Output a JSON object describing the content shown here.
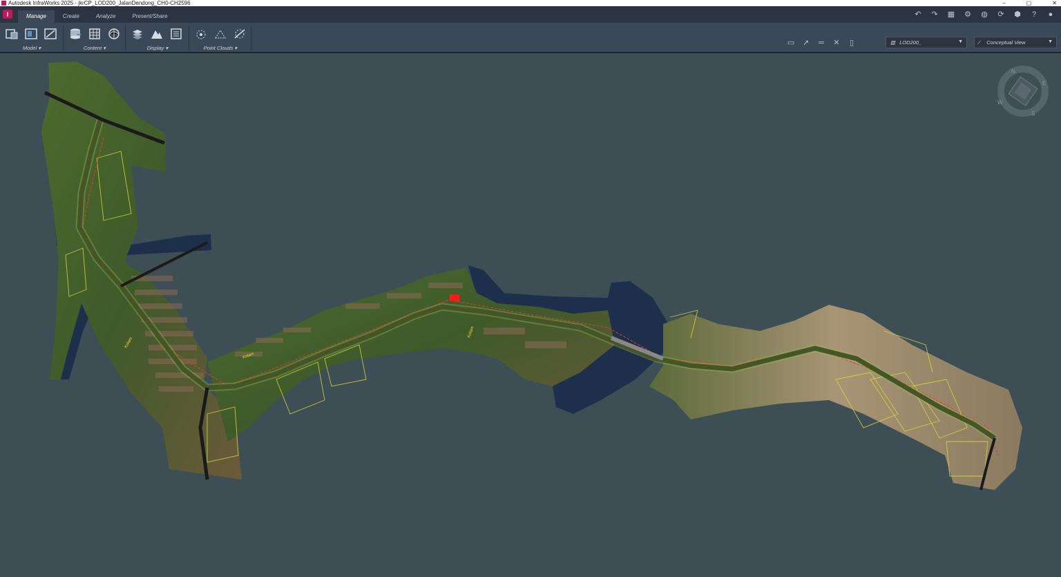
{
  "window": {
    "title": "Autodesk InfraWorks 2025 - jkrCP_LOD200_JalanDendong_CH0-CH2596",
    "controls": [
      "–",
      "▢",
      "✕"
    ]
  },
  "app_logo": "I",
  "tabs": [
    {
      "label": "Manage",
      "active": true
    },
    {
      "label": "Create",
      "active": false
    },
    {
      "label": "Analyze",
      "active": false
    },
    {
      "label": "Present/Share",
      "active": false
    }
  ],
  "ribbon_panels": {
    "model": "Model",
    "content": "Content",
    "display": "Display",
    "point_clouds": "Point Clouds"
  },
  "dropdowns": {
    "proposal": "LOD200_",
    "view_mode": "Conceptual View"
  },
  "map_labels": {
    "road_left": "Kolam",
    "road_mid": "Kolam",
    "road_center": "Kolam"
  },
  "compass": {
    "n": "N",
    "e": "E",
    "s": "S",
    "w": "W"
  },
  "colors": {
    "background": "#3e4e55",
    "ribbon": "#3b4857",
    "tabbar": "#2b3440",
    "accent": "#c2185b"
  }
}
